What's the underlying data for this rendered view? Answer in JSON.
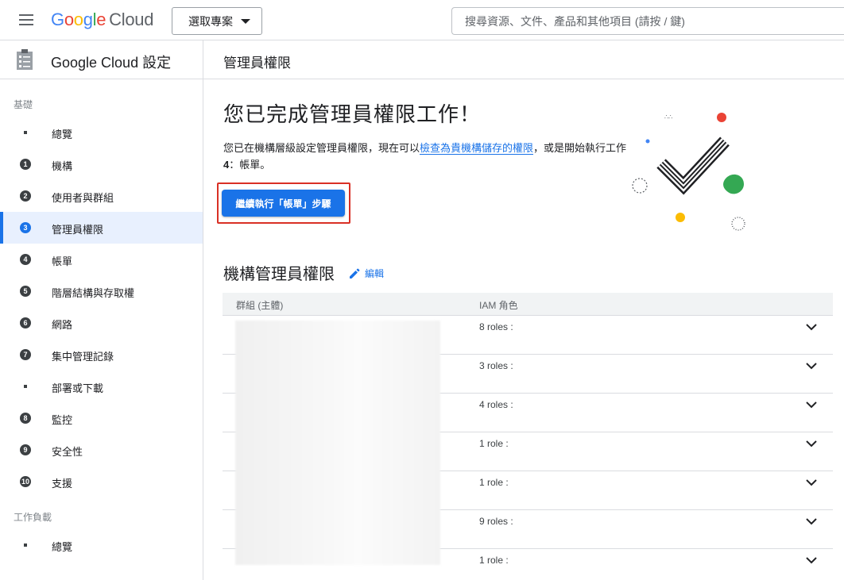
{
  "topbar": {
    "menu_icon": "hamburger-menu-icon",
    "logo": {
      "g1": "G",
      "o1": "o",
      "o2": "o",
      "g2": "g",
      "l": "l",
      "e": "e",
      "cloud": "Cloud"
    },
    "project_selector_label": "選取專案",
    "search_placeholder": "搜尋資源、文件、產品和其他項目 (請按 / 鍵)"
  },
  "sidebar": {
    "product_title": "Google Cloud 設定",
    "section_foundation": "基礎",
    "section_workloads": "工作負載",
    "items": [
      {
        "marker": "dot",
        "num": "",
        "label": "總覽",
        "active": false
      },
      {
        "marker": "num",
        "num": "1",
        "label": "機構",
        "active": false
      },
      {
        "marker": "num",
        "num": "2",
        "label": "使用者與群組",
        "active": false
      },
      {
        "marker": "num",
        "num": "3",
        "label": "管理員權限",
        "active": true
      },
      {
        "marker": "num",
        "num": "4",
        "label": "帳單",
        "active": false
      },
      {
        "marker": "num",
        "num": "5",
        "label": "階層結構與存取權",
        "active": false
      },
      {
        "marker": "num",
        "num": "6",
        "label": "網路",
        "active": false
      },
      {
        "marker": "num",
        "num": "7",
        "label": "集中管理記錄",
        "active": false
      },
      {
        "marker": "dot",
        "num": "",
        "label": "部署或下載",
        "active": false
      },
      {
        "marker": "num",
        "num": "8",
        "label": "監控",
        "active": false
      },
      {
        "marker": "num",
        "num": "9",
        "label": "安全性",
        "active": false
      },
      {
        "marker": "num",
        "num": "10",
        "label": "支援",
        "active": false
      }
    ],
    "workload_items": [
      {
        "marker": "dot",
        "label": "總覽"
      }
    ]
  },
  "main": {
    "page_title": "管理員權限",
    "hero_title": "您已完成管理員權限工作！",
    "hero_text_before": "您已在機構層級設定管理員權限，現在可以",
    "hero_link": "檢查為貴機構儲存的權限",
    "hero_text_after": "，或是開始執行工作 ",
    "hero_task_num": "4",
    "hero_text_end": "：帳單。",
    "cta_label": "繼續執行「帳單」步驟",
    "section_title": "機構管理員權限",
    "edit_label": "編輯",
    "table": {
      "col_principal": "群組 (主體)",
      "col_roles": "IAM 角色",
      "rows": [
        {
          "roles": "8 roles :"
        },
        {
          "roles": "3 roles :"
        },
        {
          "roles": "4 roles :"
        },
        {
          "roles": "1 role :"
        },
        {
          "roles": "1 role :"
        },
        {
          "roles": "9 roles :"
        },
        {
          "roles": "1 role :"
        }
      ]
    }
  },
  "colors": {
    "primary": "#1a73e8",
    "active_bg": "#e8f0fe",
    "highlight_frame": "#d93025",
    "google_blue": "#4285f4",
    "google_red": "#ea4335",
    "google_yellow": "#fbbc04",
    "google_green": "#34a853"
  }
}
